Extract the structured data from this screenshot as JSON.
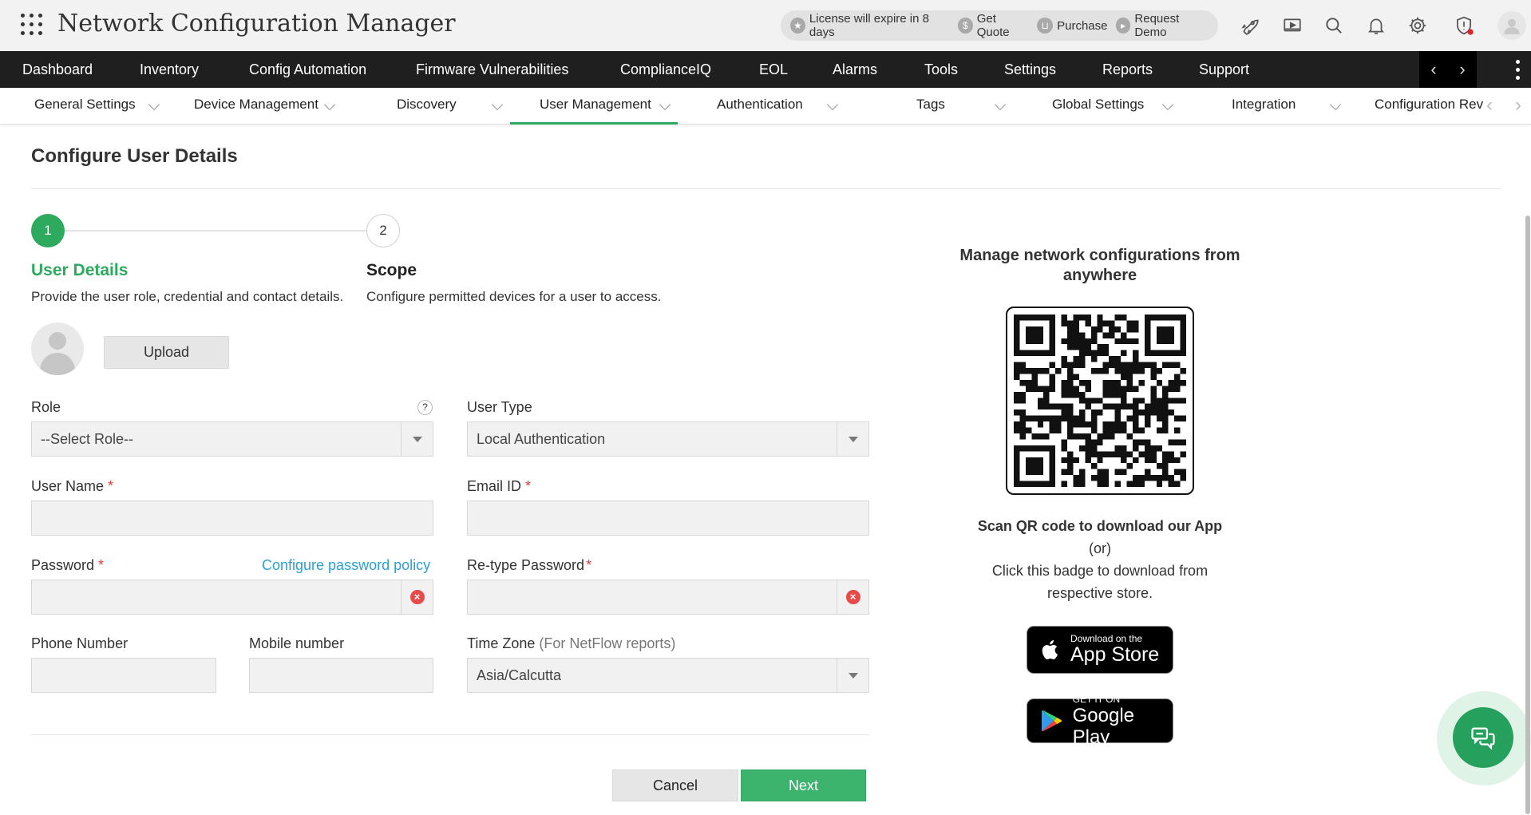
{
  "header": {
    "app_title": "Network Configuration Manager",
    "pill": {
      "license": "License will expire in 8 days",
      "get_quote": "Get Quote",
      "purchase": "Purchase",
      "request_demo": "Request Demo"
    },
    "icons": [
      "rocket-icon",
      "video-icon",
      "search-icon",
      "bell-icon",
      "gear-icon",
      "shield-alert-icon",
      "user-avatar-icon"
    ]
  },
  "main_nav": {
    "items": [
      "Dashboard",
      "Inventory",
      "Config Automation",
      "Firmware Vulnerabilities",
      "ComplianceIQ",
      "EOL",
      "Alarms",
      "Tools",
      "Settings",
      "Reports",
      "Support"
    ],
    "prev": "‹",
    "next": "›"
  },
  "sub_nav": {
    "items": [
      "General Settings",
      "Device Management",
      "Discovery",
      "User Management",
      "Authentication",
      "Tags",
      "Global Settings",
      "Integration",
      "Configuration Rev"
    ],
    "active": "User Management",
    "prev": "‹",
    "next": "›"
  },
  "page": {
    "title": "Configure User Details",
    "steps": [
      {
        "number": "1",
        "title": "User Details",
        "desc": "Provide the user role, credential and contact details."
      },
      {
        "number": "2",
        "title": "Scope",
        "desc": "Configure permitted devices for a user to access."
      }
    ],
    "upload_label": "Upload",
    "help_mark": "?",
    "form": {
      "role": {
        "label": "Role",
        "value": "--Select Role--"
      },
      "user_type": {
        "label": "User Type",
        "value": "Local Authentication"
      },
      "user_name": {
        "label": "User Name",
        "required": "*",
        "value": ""
      },
      "email": {
        "label": "Email ID",
        "required": "*",
        "value": ""
      },
      "password": {
        "label": "Password",
        "required": "*",
        "value": "",
        "policy_link": "Configure password policy"
      },
      "retype_password": {
        "label": "Re-type Password",
        "required": "*",
        "value": ""
      },
      "phone": {
        "label": "Phone Number",
        "value": ""
      },
      "mobile": {
        "label": "Mobile number",
        "value": ""
      },
      "timezone": {
        "label": "Time Zone",
        "hint": "(For NetFlow reports)",
        "value": "Asia/Calcutta"
      }
    },
    "clear_mark": "×",
    "buttons": {
      "cancel": "Cancel",
      "next": "Next"
    }
  },
  "promo": {
    "title": "Manage network configurations from anywhere",
    "scan_text": "Scan QR code to download our App",
    "or_text": "(or)",
    "badge_text": "Click this badge to download from respective store.",
    "app_store": {
      "small": "Download on the",
      "big": "App Store"
    },
    "google_play": {
      "small": "GET IT ON",
      "big": "Google Play"
    }
  },
  "colors": {
    "accent_green": "#2eaa5f",
    "nav_bg": "#1f1f1f",
    "link_blue": "#2a9fd8",
    "required_red": "#e23c3c"
  }
}
